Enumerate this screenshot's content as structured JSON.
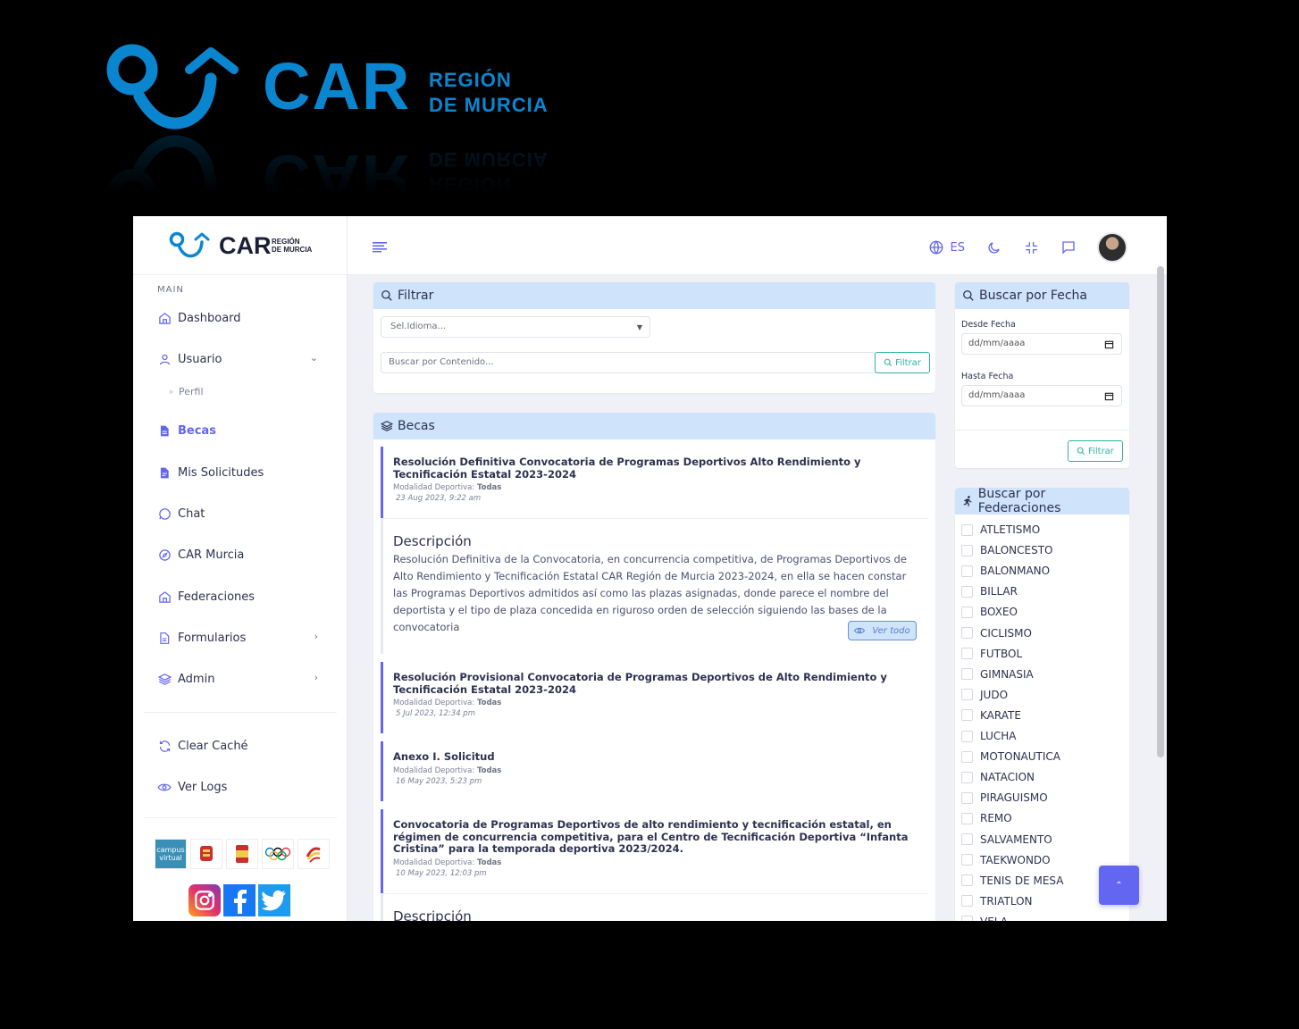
{
  "brand": {
    "car": "CAR",
    "region_line1": "REGIÓN",
    "region_line2": "DE MURCIA",
    "accent_color": "#0a86d0"
  },
  "sidebar": {
    "section_label": "MAIN",
    "items": [
      {
        "label": "Dashboard",
        "icon": "home-icon"
      },
      {
        "label": "Usuario",
        "icon": "user-icon"
      },
      {
        "label": "Becas",
        "icon": "document-icon"
      },
      {
        "label": "Mis Solicitudes",
        "icon": "document-icon"
      },
      {
        "label": "Chat",
        "icon": "chat-icon"
      },
      {
        "label": "CAR Murcia",
        "icon": "compass-icon"
      },
      {
        "label": "Federaciones",
        "icon": "home-icon"
      },
      {
        "label": "Formularios",
        "icon": "file-icon"
      },
      {
        "label": "Admin",
        "icon": "layers-icon"
      }
    ],
    "sub_item": "Perfil",
    "extra_items": [
      {
        "label": "Clear Caché",
        "icon": "refresh-icon"
      },
      {
        "label": "Ver Logs",
        "icon": "eye-icon"
      }
    ],
    "campus_label": "campus virtual"
  },
  "header": {
    "lang": "ES"
  },
  "filter": {
    "title": "Filtrar",
    "select_placeholder": "Sel.Idioma...",
    "search_placeholder": "Buscar por Contenido...",
    "button": "Filtrar"
  },
  "becas": {
    "title": "Becas",
    "modalidad_label": "Modalidad Deportiva:",
    "modalidad_value": "Todas",
    "items": [
      {
        "title": "Resolución Definitiva Convocatoria de Programas Deportivos Alto Rendimiento y Tecnificación Estatal 2023-2024",
        "date": "23 Aug 2023, 9:22 am"
      },
      {
        "title": "Resolución Provisional Convocatoria de Programas Deportivos de Alto Rendimiento y Tecnificación Estatal 2023-2024",
        "date": "5 Jul 2023, 12:34 pm"
      },
      {
        "title": "Anexo I. Solicitud",
        "date": "16 May 2023, 5:23 pm"
      },
      {
        "title": "Convocatoria de Programas Deportivos de alto rendimiento y tecnificación estatal, en régimen de concurrencia competitiva, para el Centro de Tecnificación Deportiva “Infanta Cristina” para la temporada deportiva 2023/2024.",
        "date": "10 May 2023, 12:03 pm"
      }
    ],
    "desc_title": "Descripción",
    "desc_text": "Resolución Definitiva de la Convocatoria, en concurrencia competitiva, de Programas Deportivos de Alto Rendimiento y Tecnificación Estatal CAR Región de Murcia 2023-2024, en ella se hacen constar las Programas Deportivos admitidos así como las plazas asignadas, donde parece el nombre del deportista y el tipo de plaza concedida en riguroso orden de selección siguiendo las bases de la convocatoria",
    "ver_todo": "Ver todo",
    "desc_title_2": "Descripción"
  },
  "fecha": {
    "title": "Buscar por Fecha",
    "desde_label": "Desde Fecha",
    "hasta_label": "Hasta Fecha",
    "placeholder": "dd/mm/aaaa",
    "button": "Filtrar"
  },
  "federaciones": {
    "title": "Buscar por Federaciones",
    "items": [
      "ATLETISMO",
      "BALONCESTO",
      "BALONMANO",
      "BILLAR",
      "BOXEO",
      "CICLISMO",
      "FUTBOL",
      "GIMNASIA",
      "JUDO",
      "KARATE",
      "LUCHA",
      "MOTONAUTICA",
      "NATACION",
      "PIRAGUISMO",
      "REMO",
      "SALVAMENTO",
      "TAEKWONDO",
      "TENIS DE MESA",
      "TRIATLON",
      "VELA"
    ]
  }
}
